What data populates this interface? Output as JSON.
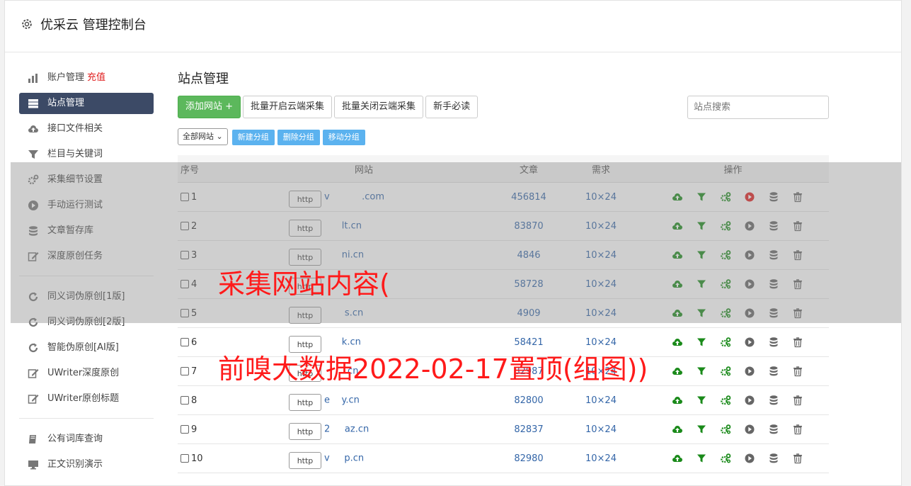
{
  "header": {
    "title": "优采云 管理控制台"
  },
  "sidebar": {
    "items": [
      {
        "label": "账户管理",
        "badge": "充值",
        "icon": "bar-chart-icon"
      },
      {
        "label": "站点管理",
        "icon": "server-icon",
        "active": true
      },
      {
        "label": "接口文件相关",
        "icon": "cloud-upload-icon"
      },
      {
        "label": "栏目与关键词",
        "icon": "filter-icon"
      },
      {
        "label": "采集细节设置",
        "icon": "gears-icon"
      },
      {
        "label": "手动运行测试",
        "icon": "play-circle-icon"
      },
      {
        "label": "文章暂存库",
        "icon": "database-icon"
      },
      {
        "label": "深度原创任务",
        "icon": "edit-icon"
      }
    ],
    "items2": [
      {
        "label": "同义词伪原创[1版]",
        "icon": "refresh-icon"
      },
      {
        "label": "同义词伪原创[2版]",
        "icon": "refresh-icon"
      },
      {
        "label": "智能伪原创[AI版]",
        "icon": "refresh-icon"
      },
      {
        "label": "UWriter深度原创",
        "icon": "edit-icon"
      },
      {
        "label": "UWriter原创标题",
        "icon": "edit-icon"
      }
    ],
    "items3": [
      {
        "label": "公有词库查询",
        "icon": "book-icon"
      },
      {
        "label": "正文识别演示",
        "icon": "monitor-icon"
      }
    ]
  },
  "main": {
    "title": "站点管理",
    "toolbar": {
      "add_site": "添加网站 +",
      "batch_open": "批量开启云端采集",
      "batch_close": "批量关闭云端采集",
      "newbie": "新手必读",
      "search_placeholder": "站点搜索"
    },
    "group_select": "全部网站",
    "group_buttons": {
      "new": "新建分组",
      "delete": "删除分组",
      "move": "移动分组"
    },
    "table": {
      "headers": {
        "no": "序号",
        "site": "网站",
        "articles": "文章",
        "demand": "需求",
        "ops": "操作"
      },
      "http_label": "http",
      "rows": [
        {
          "no": "1",
          "site": "v           .com",
          "articles": "456814",
          "demand": "10×24",
          "running": true
        },
        {
          "no": "2",
          "site": "      lt.cn",
          "articles": "83870",
          "demand": "10×24",
          "running": false
        },
        {
          "no": "3",
          "site": "      ni.cn",
          "articles": "4846",
          "demand": "10×24",
          "running": false
        },
        {
          "no": "4",
          "site": "             ",
          "articles": "58728",
          "demand": "10×24",
          "running": false
        },
        {
          "no": "5",
          "site": "       s.cn",
          "articles": "4909",
          "demand": "10×24",
          "running": false
        },
        {
          "no": "6",
          "site": "      k.cn",
          "articles": "58421",
          "demand": "10×24",
          "running": false
        },
        {
          "no": "7",
          "site": "       .cn",
          "articles": "82987",
          "demand": "10×24",
          "running": false
        },
        {
          "no": "8",
          "site": "e    y.cn",
          "articles": "82800",
          "demand": "10×24",
          "running": false
        },
        {
          "no": "9",
          "site": "2     az.cn",
          "articles": "82837",
          "demand": "10×24",
          "running": false
        },
        {
          "no": "10",
          "site": "v     p.cn",
          "articles": "82980",
          "demand": "10×24",
          "running": false
        }
      ]
    }
  },
  "overlay_text": {
    "line1": "采集网站内容(",
    "line2": "前嗅大数据2022-02-17置顶(组图))"
  },
  "colors": {
    "green": "#1a8a1a",
    "red_play": "#e02020",
    "link_blue": "#3466a8",
    "active_nav": "#3c4a66"
  }
}
